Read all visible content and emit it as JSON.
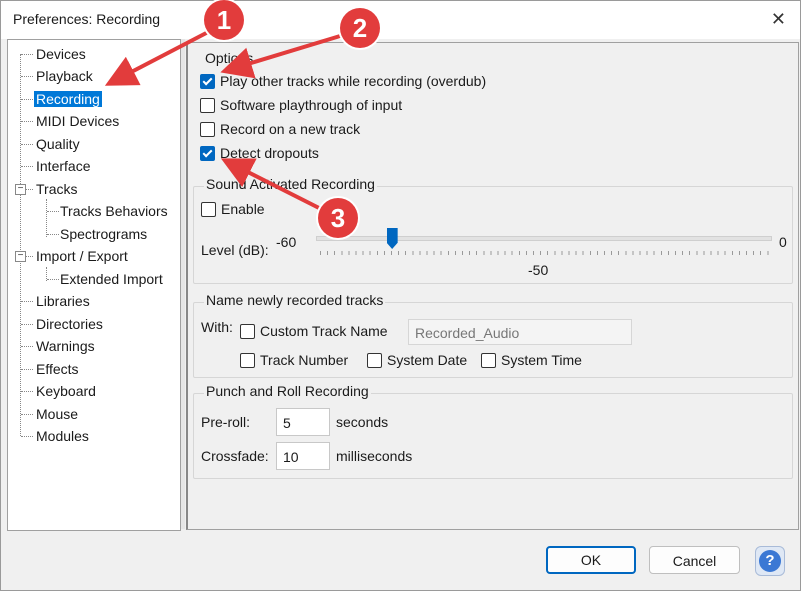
{
  "window": {
    "title": "Preferences: Recording"
  },
  "tree": {
    "items": [
      "Devices",
      "Playback",
      "Recording",
      "MIDI Devices",
      "Quality",
      "Interface",
      "Tracks",
      "Tracks Behaviors",
      "Spectrograms",
      "Import / Export",
      "Extended Import",
      "Libraries",
      "Directories",
      "Warnings",
      "Effects",
      "Keyboard",
      "Mouse",
      "Modules"
    ],
    "selected": "Recording"
  },
  "options": {
    "title": "Options",
    "overdub": "Play other tracks while recording (overdub)",
    "playthrough": "Software playthrough of input",
    "new_track": "Record on a new track",
    "dropouts": "Detect dropouts"
  },
  "sound_activated": {
    "title": "Sound Activated Recording",
    "enable": "Enable",
    "level_label": "Level (dB):",
    "min": "-60",
    "max": "0",
    "value": "-50",
    "value_num": -50
  },
  "naming": {
    "title": "Name newly recorded tracks",
    "with": "With:",
    "custom": "Custom Track Name",
    "custom_value": "Recorded_Audio",
    "track_number": "Track Number",
    "system_date": "System Date",
    "system_time": "System Time"
  },
  "punch": {
    "title": "Punch and Roll Recording",
    "preroll_label": "Pre-roll:",
    "preroll_value": "5",
    "preroll_unit": "seconds",
    "crossfade_label": "Crossfade:",
    "crossfade_value": "10",
    "crossfade_unit": "milliseconds"
  },
  "buttons": {
    "ok": "OK",
    "cancel": "Cancel",
    "help": "?"
  },
  "annotations": [
    "1",
    "2",
    "3"
  ],
  "colors": {
    "accent": "#0067c0",
    "annotation": "#e23c3c"
  }
}
